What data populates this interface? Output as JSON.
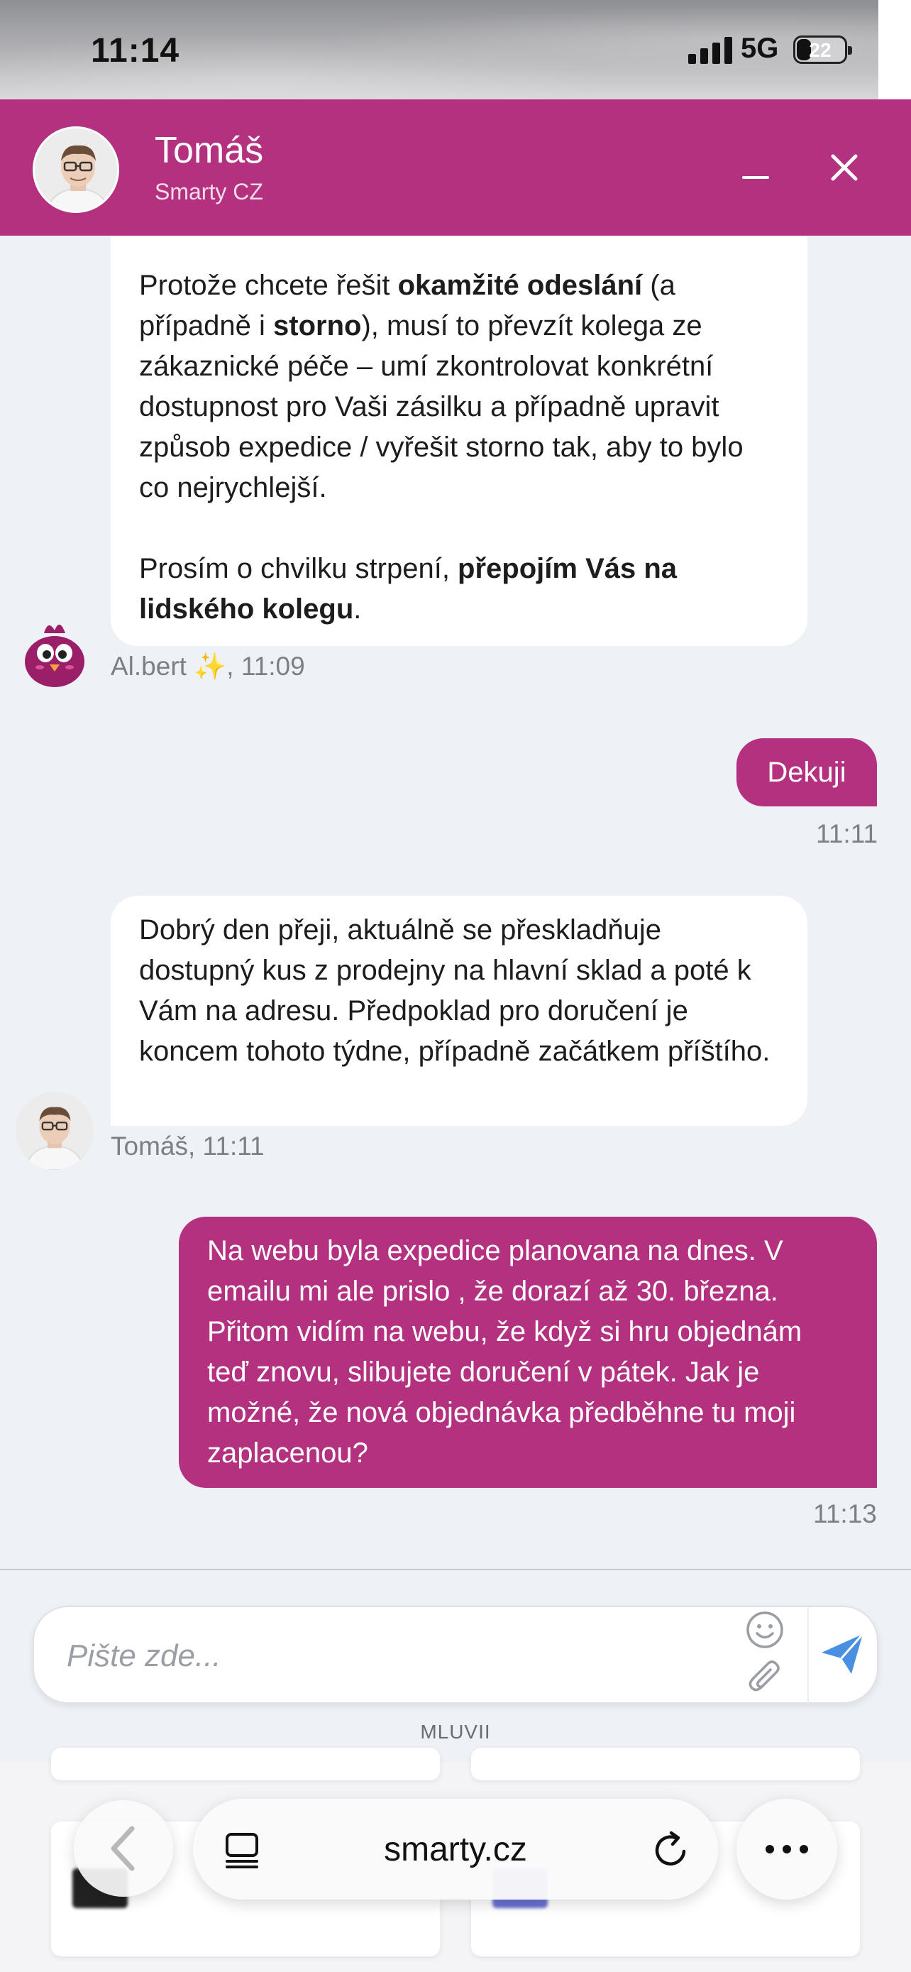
{
  "status_bar": {
    "time": "11:14",
    "network": "5G",
    "battery": "22"
  },
  "header": {
    "agent_name": "Tomáš",
    "company": "Smarty CZ",
    "minimize_icon": "minus-icon",
    "close_icon": "close-icon"
  },
  "messages": {
    "m1": {
      "p1_a": "Protože chcete řešit ",
      "p1_b": "okamžité odeslání",
      "p1_c": " (a případně i ",
      "p1_d": "storno",
      "p1_e": "), musí to převzít kolega ze zákaznické péče – umí zkontrolovat konkrétní dostupnost pro Vaši zásilku a případně upravit způsob expedice / vyřešit storno tak, aby to bylo co nejrychlejší.",
      "p2_a": "Prosím o chvilku strpení, ",
      "p2_b": "přepojím Vás na lidského kolegu",
      "p2_c": ".",
      "meta": "Al.bert ✨, 11:09"
    },
    "m2": {
      "text": "Dekuji",
      "time": "11:11"
    },
    "m3": {
      "text": "Dobrý den přeji, aktuálně se přeskladňuje dostupný kus z prodejny na hlavní sklad a poté k Vám na adresu. Předpoklad pro doručení je koncem tohoto týdne, případně začátkem příštího.",
      "meta": "Tomáš, 11:11"
    },
    "m4": {
      "text": "Na webu byla expedice planovana na dnes. V emailu mi ale prislo , že dorazí až 30. března. Přitom vidím na webu, že když si hru objednám teď znovu, slibujete doručení v pátek. Jak je možné, že nová objednávka předběhne tu moji zaplacenou?",
      "time": "11:13"
    }
  },
  "composer": {
    "placeholder": "Pište zde...",
    "branding": "MLUVII"
  },
  "browser": {
    "url": "smarty.cz"
  },
  "colors": {
    "brand": "#b3317f",
    "background": "#eef1f5",
    "send": "#4a90e2"
  }
}
